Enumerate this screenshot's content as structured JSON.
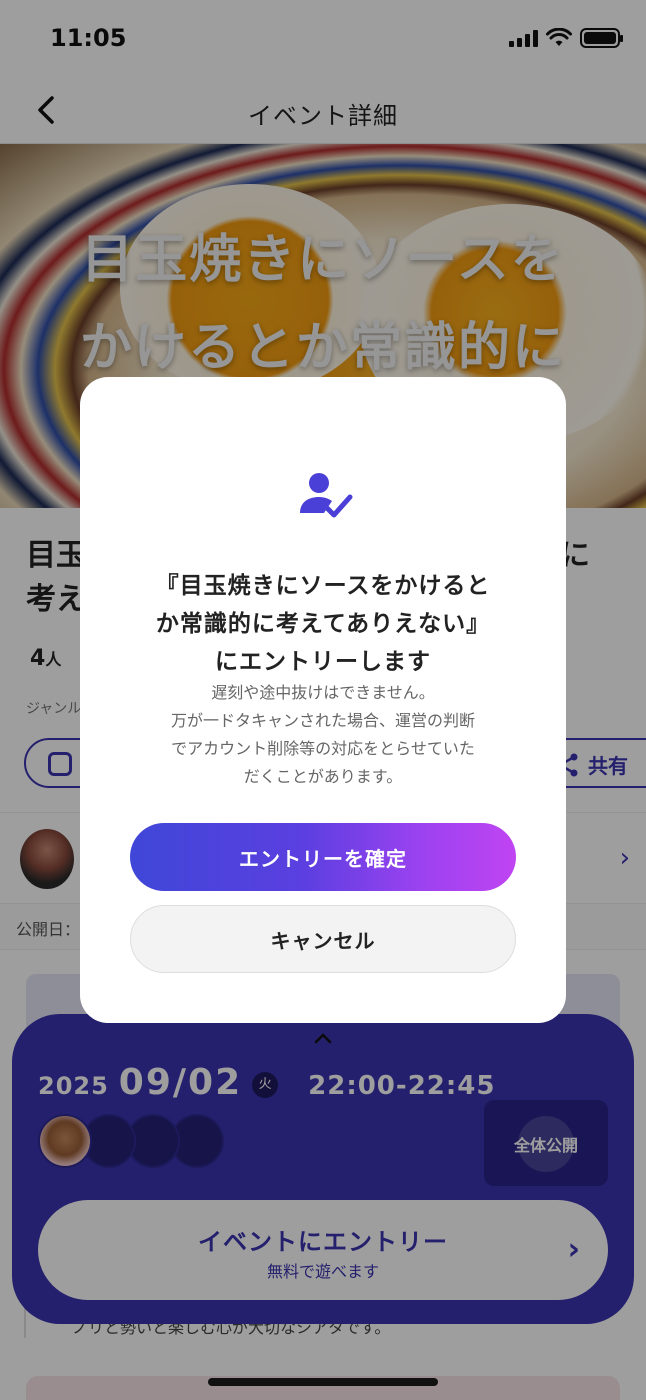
{
  "status_bar": {
    "time": "11:05"
  },
  "nav": {
    "title": "イベント詳細"
  },
  "hero": {
    "text_line1": "目玉焼きにソースを",
    "text_line2": "かけるとか常識的に"
  },
  "event": {
    "title_fragment_line1": "目玉",
    "title_fragment_line1_right": "に",
    "title_fragment_line2": "考え",
    "participants_count": "4",
    "participants_unit": "人",
    "genre_label": "ジャンル",
    "share_label": "共有",
    "publish_label": "公開日："
  },
  "sheet": {
    "year": "2025",
    "month_day": "09/02",
    "weekday": "火",
    "time_range": "22:00-22:45",
    "public_badge": "全体公開",
    "cta_main": "イベントにエントリー",
    "cta_sub": "無料で遊べます"
  },
  "description_fragment": "ノリと勢いと楽しむ心が大切なシアタです。",
  "modal": {
    "title_line1": "『目玉焼きにソースをかけると",
    "title_line2": "か常識的に考えてありえない』",
    "title_line3": "にエントリーします",
    "body_line1": "遅刻や途中抜けはできません。",
    "body_line2": "万が一ドタキャンされた場合、運営の判断",
    "body_line3": "でアカウント削除等の対応をとらせていた",
    "body_line4": "だくことがあります。",
    "confirm_label": "エントリーを確定",
    "cancel_label": "キャンセル"
  },
  "colors": {
    "primary": "#3b35b0",
    "gradient_start": "#3f47d8",
    "gradient_end": "#c044f2"
  }
}
